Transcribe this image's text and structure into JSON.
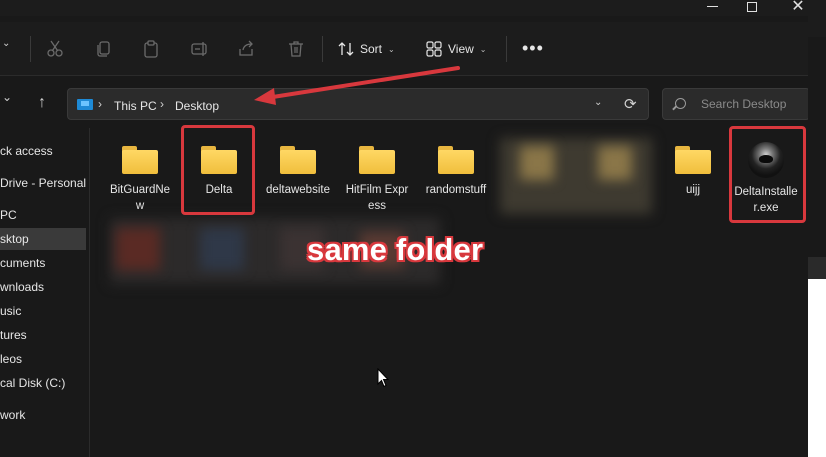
{
  "window": {
    "minimize_label": "minimize",
    "maximize_label": "maximize",
    "close_glyph": "✕"
  },
  "toolbar": {
    "new_chevron": "⌄",
    "sort_label": "Sort",
    "view_label": "View",
    "more_label": "•••",
    "icons": [
      "cut-icon",
      "copy-icon",
      "paste-icon",
      "rename-icon",
      "share-icon",
      "delete-icon"
    ]
  },
  "navbar": {
    "back_chevron": "⌄",
    "up_arrow": "↑",
    "breadcrumb": [
      "This PC",
      "Desktop"
    ],
    "crumb_sep": "›",
    "search_placeholder": "Search Desktop",
    "refresh_glyph": "⟳",
    "dropdown_glyph": "⌄"
  },
  "sidebar": {
    "items": [
      {
        "label": "ck access"
      },
      {
        "label": "Drive - Personal"
      },
      {
        "label": "PC"
      },
      {
        "label": "sktop",
        "selected": true
      },
      {
        "label": "cuments"
      },
      {
        "label": "wnloads"
      },
      {
        "label": "usic"
      },
      {
        "label": "tures"
      },
      {
        "label": "leos"
      },
      {
        "label": "cal Disk (C:)"
      },
      {
        "label": "work"
      }
    ]
  },
  "files": [
    {
      "name": "BitGuardNew",
      "type": "folder"
    },
    {
      "name": "Delta",
      "type": "folder"
    },
    {
      "name": "deltawebsite",
      "type": "folder"
    },
    {
      "name": "HitFilm Express",
      "type": "folder"
    },
    {
      "name": "randomstuff",
      "type": "folder"
    },
    {
      "name": "uijj",
      "type": "folder"
    },
    {
      "name": "DeltaInstaller.exe",
      "type": "application"
    }
  ],
  "annotation": {
    "text": "same folder",
    "color": "#d8383d"
  },
  "colors": {
    "background": "#191919",
    "folder": "#f5c74e",
    "highlight": "#d8383d"
  }
}
